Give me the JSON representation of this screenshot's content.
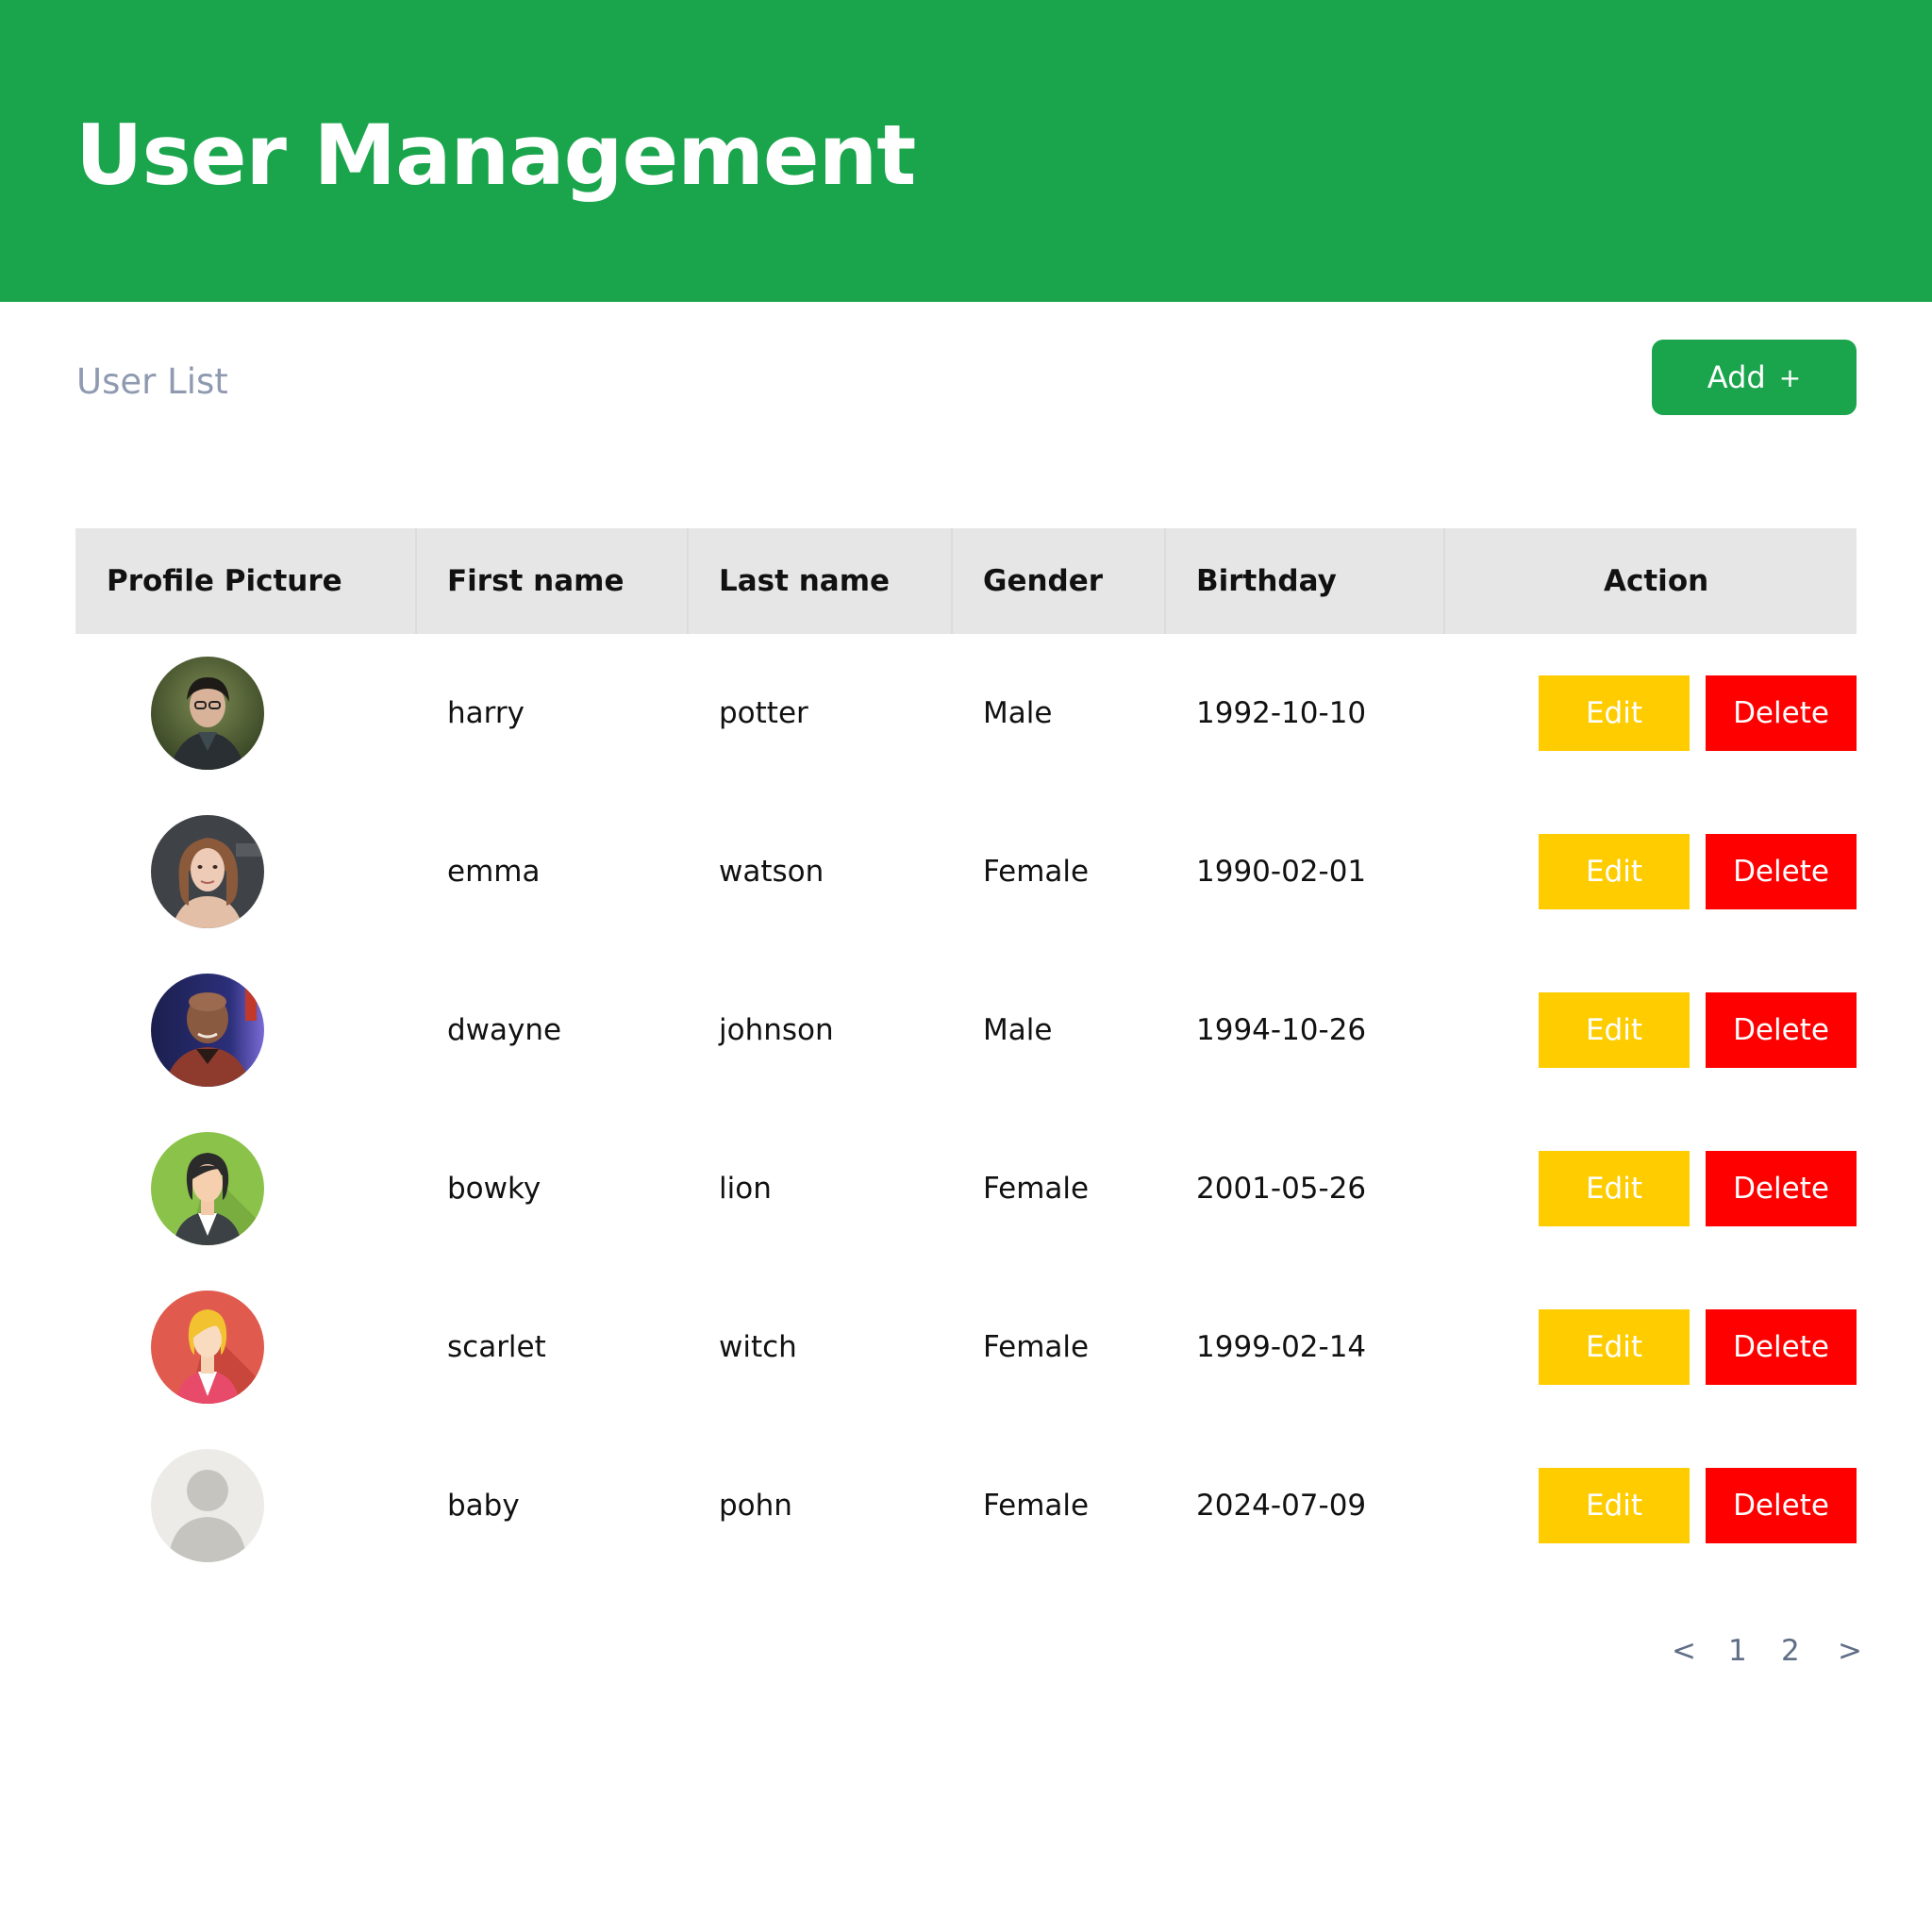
{
  "header": {
    "title": "User Management"
  },
  "subtitle": "User List",
  "add_button": {
    "label": "Add",
    "icon": "+"
  },
  "table": {
    "columns": [
      "Profile Picture",
      "First name",
      "Last name",
      "Gender",
      "Birthday",
      "Action"
    ],
    "rows": [
      {
        "first_name": "harry",
        "last_name": "potter",
        "gender": "Male",
        "birthday": "1992-10-10",
        "edit_label": "Edit",
        "delete_label": "Delete",
        "avatar": "photo-portrait"
      },
      {
        "first_name": "emma",
        "last_name": "watson",
        "gender": "Female",
        "birthday": "1990-02-01",
        "edit_label": "Edit",
        "delete_label": "Delete",
        "avatar": "photo-portrait"
      },
      {
        "first_name": "dwayne",
        "last_name": "johnson",
        "gender": "Male",
        "birthday": "1994-10-26",
        "edit_label": "Edit",
        "delete_label": "Delete",
        "avatar": "photo-portrait"
      },
      {
        "first_name": "bowky",
        "last_name": "lion",
        "gender": "Female",
        "birthday": "2001-05-26",
        "edit_label": "Edit",
        "delete_label": "Delete",
        "avatar": "businesswoman-green"
      },
      {
        "first_name": "scarlet",
        "last_name": "witch",
        "gender": "Female",
        "birthday": "1999-02-14",
        "edit_label": "Edit",
        "delete_label": "Delete",
        "avatar": "businesswoman-red"
      },
      {
        "first_name": "baby",
        "last_name": "pohn",
        "gender": "Female",
        "birthday": "2024-07-09",
        "edit_label": "Edit",
        "delete_label": "Delete",
        "avatar": "default-user"
      }
    ]
  },
  "pagination": {
    "prev": "<",
    "pages": [
      "1",
      "2"
    ],
    "next": ">"
  },
  "colors": {
    "brand_green": "#1aa54c",
    "edit_yellow": "#ffcc00",
    "delete_red": "#ff0000",
    "header_gray": "#e6e6e6",
    "subtitle_gray": "#8f9ab0"
  }
}
